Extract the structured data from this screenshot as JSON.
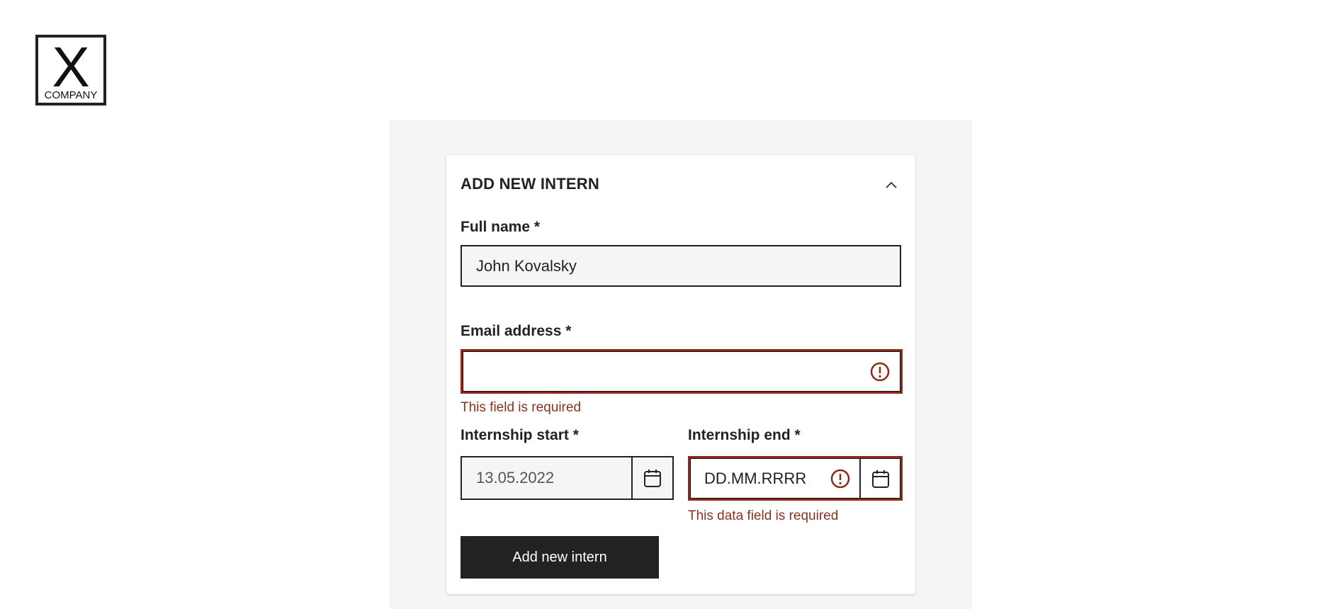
{
  "logo": {
    "mark": "X",
    "text": "COMPANY"
  },
  "card": {
    "title": "ADD NEW INTERN",
    "collapse_icon": "chevron-up-icon"
  },
  "form": {
    "full_name": {
      "label": "Full name *",
      "value": "John Kovalsky"
    },
    "email": {
      "label": "Email address *",
      "value": "",
      "error": "This field is required",
      "error_icon": "alert-circle-icon"
    },
    "internship_start": {
      "label": "Internship start *",
      "value": "13.05.2022",
      "calendar_icon": "calendar-icon"
    },
    "internship_end": {
      "label": "Internship end *",
      "placeholder": "DD.MM.RRRR",
      "error": "This data field is required",
      "error_icon": "alert-circle-icon",
      "calendar_icon": "calendar-icon"
    },
    "submit_label": "Add new intern"
  },
  "colors": {
    "primary": "#222222",
    "error": "#8a2a18",
    "panel_background": "#f5f5f5",
    "input_background": "#f5f5f5"
  }
}
